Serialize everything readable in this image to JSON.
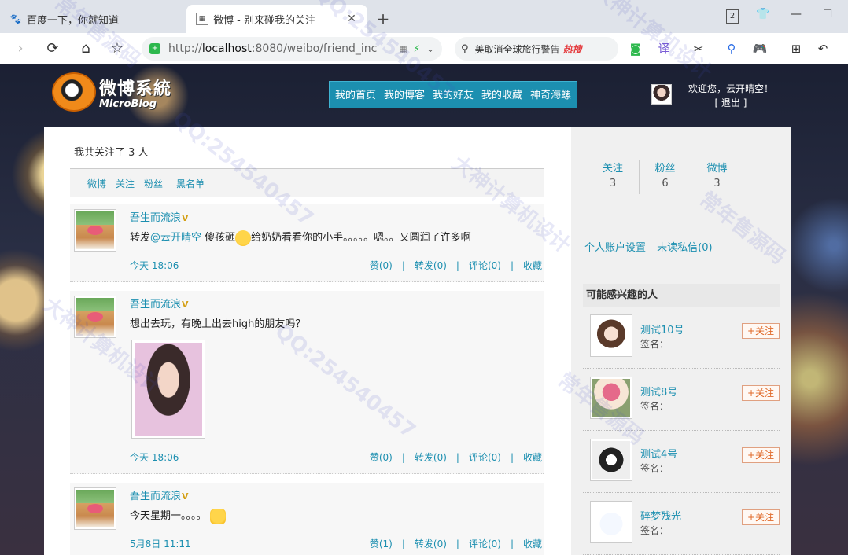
{
  "browser": {
    "tabs": [
      {
        "title": "百度一下，你就知道",
        "active": false
      },
      {
        "title": "微博 - 别来碰我的关注",
        "active": true
      }
    ],
    "tab_count_badge": "2",
    "url_prefix": "http://",
    "url_host": "localhost",
    "url_rest": ":8080/weibo/friend_inc",
    "search_text": "美取消全球旅行警告",
    "search_hot": "热搜"
  },
  "site": {
    "logo_cn": "微博系統",
    "logo_en": "MicroBlog",
    "nav": [
      "我的首页",
      "我的博客",
      "我的好友",
      "我的收藏",
      "神奇海螺"
    ],
    "welcome": "欢迎您，云开晴空！",
    "logout": "[ 退出 ]"
  },
  "main": {
    "follow_count": "我共关注了 3 人",
    "subtabs": [
      "微博",
      "关注",
      "粉丝",
      "黑名单"
    ],
    "posts": [
      {
        "author": "吾生而流浪",
        "text_before": "转发",
        "mention": "@云开晴空",
        "text_mid": " 傻孩砸",
        "text_after": "给奶奶看看你的小手。。。。。嗯。。又圆润了许多啊",
        "time": "今天 18:06",
        "likes": "赞(0)",
        "reposts": "转发(0)",
        "comments": "评论(0)",
        "fav": "收藏"
      },
      {
        "author": "吾生而流浪",
        "text": "想出去玩，有晚上出去high的朋友吗？",
        "time": "今天 18:06",
        "likes": "赞(0)",
        "reposts": "转发(0)",
        "comments": "评论(0)",
        "fav": "收藏"
      },
      {
        "author": "吾生而流浪",
        "text": "今天星期一。。。。",
        "time": "5月8日 11:11",
        "likes": "赞(1)",
        "reposts": "转发(0)",
        "comments": "评论(0)",
        "fav": "收藏"
      }
    ]
  },
  "sidebar": {
    "stats": [
      {
        "label": "关注",
        "value": "3"
      },
      {
        "label": "粉丝",
        "value": "6"
      },
      {
        "label": "微博",
        "value": "3"
      }
    ],
    "account_settings": "个人账户设置",
    "unread_messages": "未读私信(0)",
    "maybe_interested": "可能感兴趣的人",
    "recommendations": [
      {
        "name": "测试10号",
        "signature": "签名：",
        "button": "+关注"
      },
      {
        "name": "测试8号",
        "signature": "签名：",
        "button": "+关注"
      },
      {
        "name": "测试4号",
        "signature": "签名：",
        "button": "+关注"
      },
      {
        "name": "碎梦残光",
        "signature": "签名：",
        "button": "+关注"
      }
    ]
  },
  "watermark": {
    "texts": [
      "常年售源码",
      "大神计算机设计",
      "QQ:254540457"
    ]
  }
}
